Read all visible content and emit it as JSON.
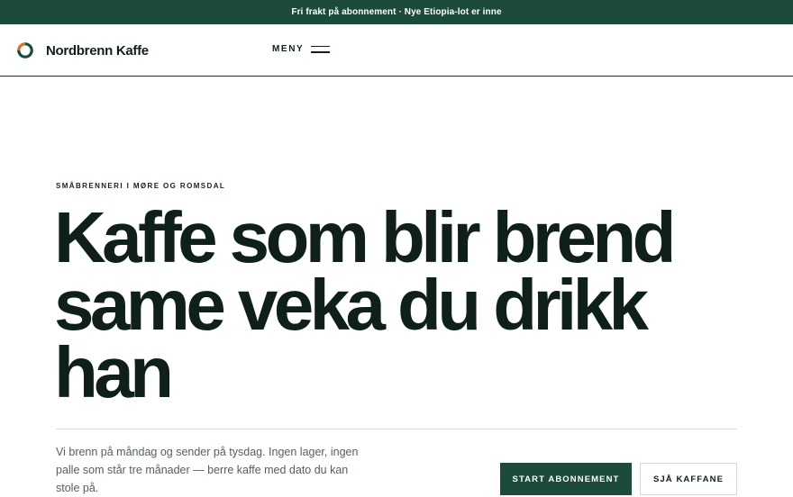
{
  "announcement": {
    "text": "Fri frakt på abonnement · Nye Etiopia-lot er inne"
  },
  "header": {
    "brand_name": "Nordbrenn Kaffe",
    "menu_label": "MENY"
  },
  "hero": {
    "eyebrow": "SMÅBRENNERI I MØRE OG ROMSDAL",
    "headline": "Kaffe som blir brend same veka du drikk han",
    "intro": "Vi brenn på måndag og sender på tysdag. Ingen lager, ingen palle som står tre månader — berre kaffe med dato du kan stole på.",
    "primary_cta": "START ABONNEMENT",
    "secondary_cta": "SJÅ KAFFANE"
  },
  "colors": {
    "brand_green": "#1c4a3c",
    "accent_orange": "#d9732e",
    "text_dark": "#0f1f1a",
    "text_muted": "#55605c"
  },
  "icons": {
    "logo": "ring-logo-icon",
    "menu": "hamburger-icon"
  }
}
